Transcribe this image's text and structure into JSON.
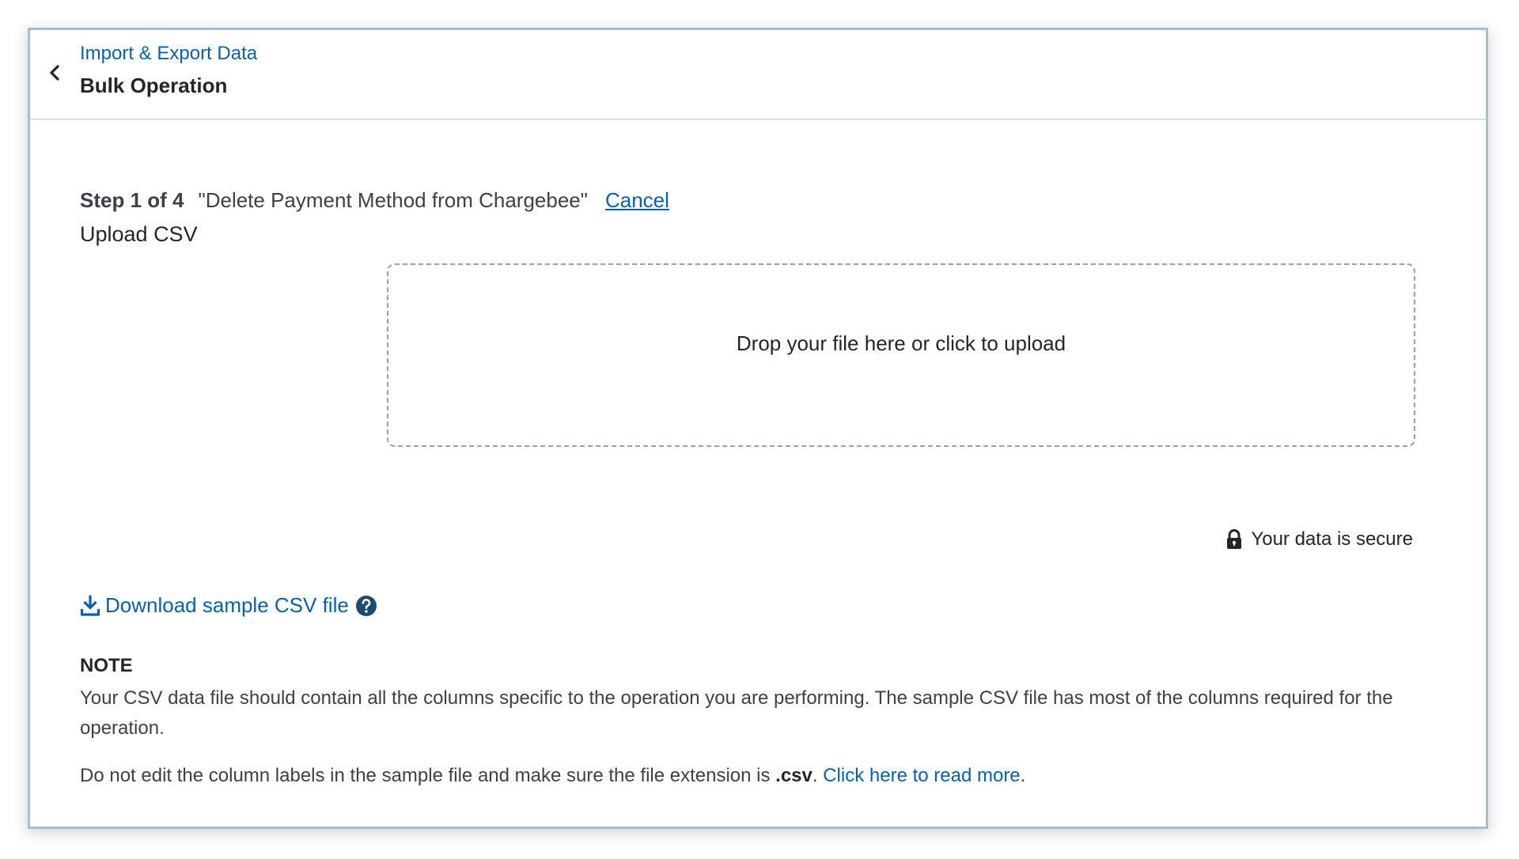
{
  "header": {
    "breadcrumb": "Import & Export Data",
    "title": "Bulk Operation",
    "back_icon": "chevron-left-icon"
  },
  "step": {
    "label": "Step 1 of 4",
    "operation": "\"Delete Payment Method from Chargebee\"",
    "cancel": "Cancel",
    "subtitle": "Upload CSV"
  },
  "dropzone": {
    "text": "Drop your file here or click to upload"
  },
  "security": {
    "icon": "lock-icon",
    "text": "Your data is secure"
  },
  "download": {
    "icon": "download-icon",
    "label": "Download sample CSV file",
    "help_icon": "question-circle-icon"
  },
  "note": {
    "title": "NOTE",
    "paragraph1": "Your CSV data file should contain all the columns specific to the operation you are performing. The sample CSV file has most of the columns required for the operation.",
    "paragraph2_prefix": "Do not edit the column labels in the sample file and make sure the file extension is ",
    "paragraph2_ext": ".csv",
    "paragraph2_sep": ". ",
    "read_more": "Click here to read more",
    "paragraph2_end": "."
  },
  "colors": {
    "link": "#0b5fa8",
    "text": "#22262b",
    "border": "#a9bfcc"
  }
}
